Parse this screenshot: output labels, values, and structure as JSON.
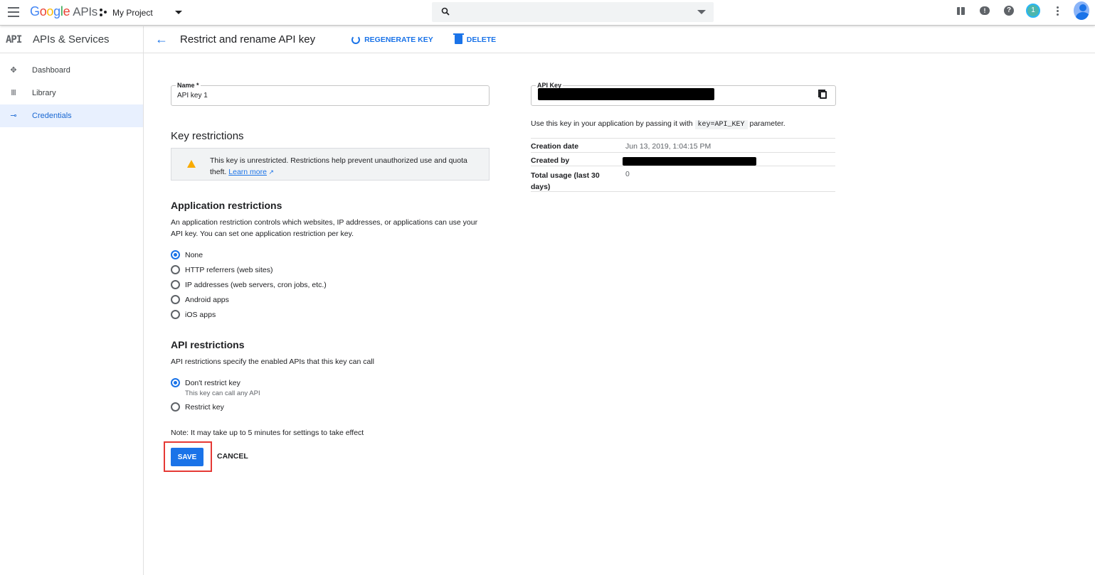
{
  "topbar": {
    "logo_letters": [
      "G",
      "o",
      "o",
      "g",
      "l",
      "e"
    ],
    "logo_suffix": "APIs",
    "project_name": "My Project",
    "notification_count": "1"
  },
  "sidebar": {
    "badge": "API",
    "title": "APIs & Services",
    "items": [
      {
        "label": "Dashboard",
        "icon": "dashboard-icon",
        "active": false
      },
      {
        "label": "Library",
        "icon": "library-icon",
        "active": false
      },
      {
        "label": "Credentials",
        "icon": "key-icon",
        "active": true
      }
    ]
  },
  "header": {
    "title": "Restrict and rename API key",
    "regenerate_label": "REGENERATE KEY",
    "delete_label": "DELETE"
  },
  "form": {
    "name_label": "Name *",
    "name_value": "API key 1",
    "key_restrictions_heading": "Key restrictions",
    "warning_text": "This key is unrestricted. Restrictions help prevent unauthorized use and quota theft.",
    "warning_link": "Learn more",
    "app_restrictions_heading": "Application restrictions",
    "app_restrictions_desc": "An application restriction controls which websites, IP addresses, or applications can use your API key. You can set one application restriction per key.",
    "app_options": [
      {
        "label": "None",
        "selected": true
      },
      {
        "label": "HTTP referrers (web sites)",
        "selected": false
      },
      {
        "label": "IP addresses (web servers, cron jobs, etc.)",
        "selected": false
      },
      {
        "label": "Android apps",
        "selected": false
      },
      {
        "label": "iOS apps",
        "selected": false
      }
    ],
    "api_restrictions_heading": "API restrictions",
    "api_restrictions_desc": "API restrictions specify the enabled APIs that this key can call",
    "api_options": [
      {
        "label": "Don't restrict key",
        "hint": "This key can call any API",
        "selected": true
      },
      {
        "label": "Restrict key",
        "hint": "",
        "selected": false
      }
    ],
    "note": "Note: It may take up to 5 minutes for settings to take effect",
    "save_label": "SAVE",
    "cancel_label": "CANCEL"
  },
  "details": {
    "api_key_label": "API Key",
    "usage_prefix": "Use this key in your application by passing it with",
    "usage_code": "key=API_KEY",
    "usage_suffix": "parameter.",
    "rows": [
      {
        "key": "Creation date",
        "value": "Jun 13, 2019, 1:04:15 PM"
      },
      {
        "key": "Created by",
        "value": ""
      },
      {
        "key": "Total usage (last 30 days)",
        "value": "0"
      }
    ]
  },
  "colors": {
    "accent": "#1a73e8",
    "warning": "#f9ab00",
    "highlight": "#e53935"
  }
}
